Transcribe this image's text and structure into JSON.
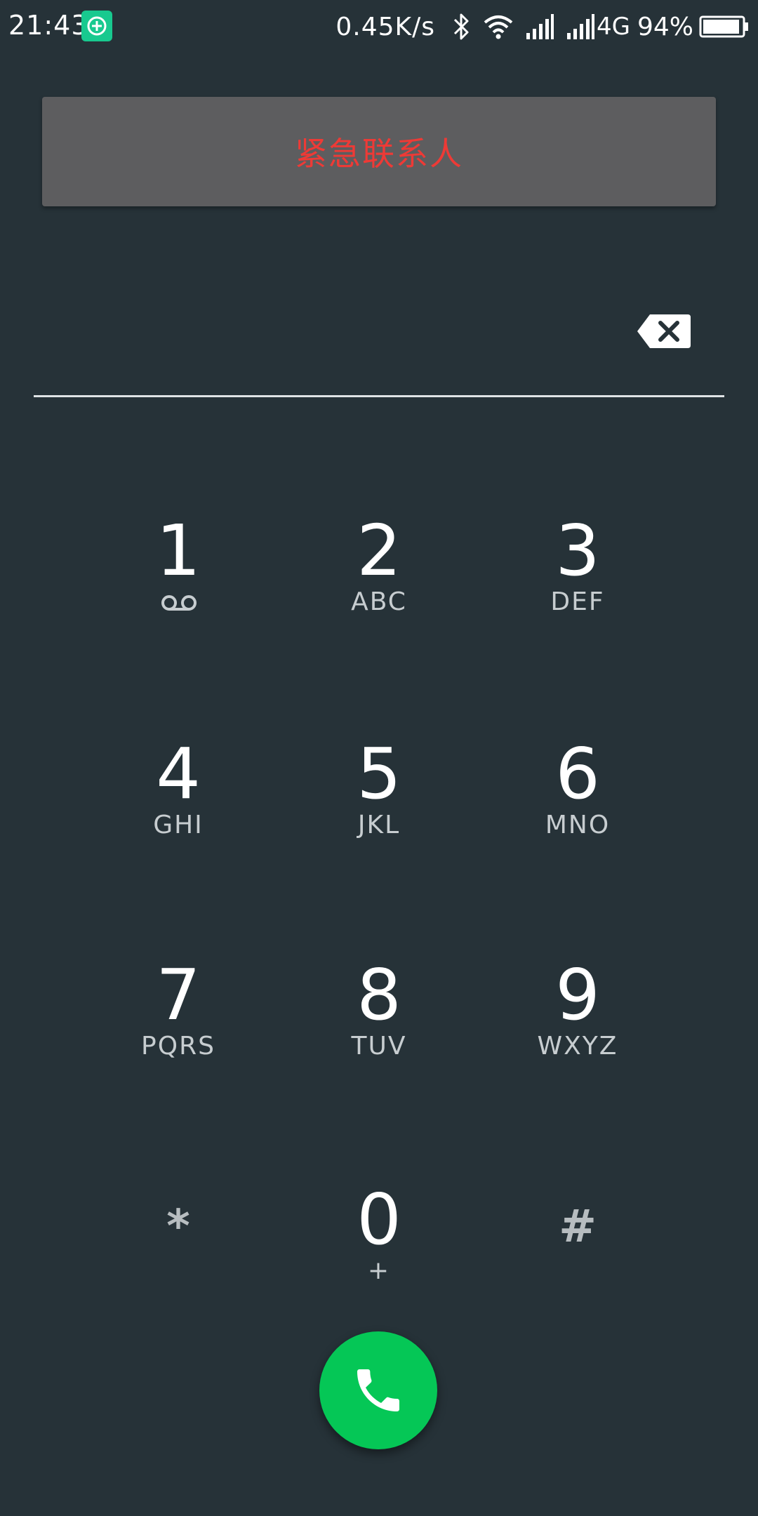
{
  "status_bar": {
    "time": "21:43",
    "app_icon": "app-notification-icon",
    "net_speed": "0.45K/s",
    "bluetooth_icon": "bluetooth-icon",
    "wifi_icon": "wifi-icon",
    "signal_icon": "signal-icon",
    "network_type": "4G",
    "battery_percent": "94%",
    "battery_level": 0.94
  },
  "emergency": {
    "label": "紧急联系人",
    "color": "#ee3a36"
  },
  "dial_input": {
    "value": ""
  },
  "keypad": {
    "keys": [
      {
        "digit": "1",
        "letters": "",
        "icon": "voicemail-icon"
      },
      {
        "digit": "2",
        "letters": "ABC"
      },
      {
        "digit": "3",
        "letters": "DEF"
      },
      {
        "digit": "4",
        "letters": "GHI"
      },
      {
        "digit": "5",
        "letters": "JKL"
      },
      {
        "digit": "6",
        "letters": "MNO"
      },
      {
        "digit": "7",
        "letters": "PQRS"
      },
      {
        "digit": "8",
        "letters": "TUV"
      },
      {
        "digit": "9",
        "letters": "WXYZ"
      },
      {
        "digit": "*",
        "letters": ""
      },
      {
        "digit": "0",
        "letters": "+"
      },
      {
        "digit": "#",
        "letters": ""
      }
    ]
  },
  "call_button": {
    "icon": "phone-icon",
    "color": "#05c756"
  },
  "colors": {
    "background": "#263238",
    "emergency_button": "#5d5d5f"
  }
}
